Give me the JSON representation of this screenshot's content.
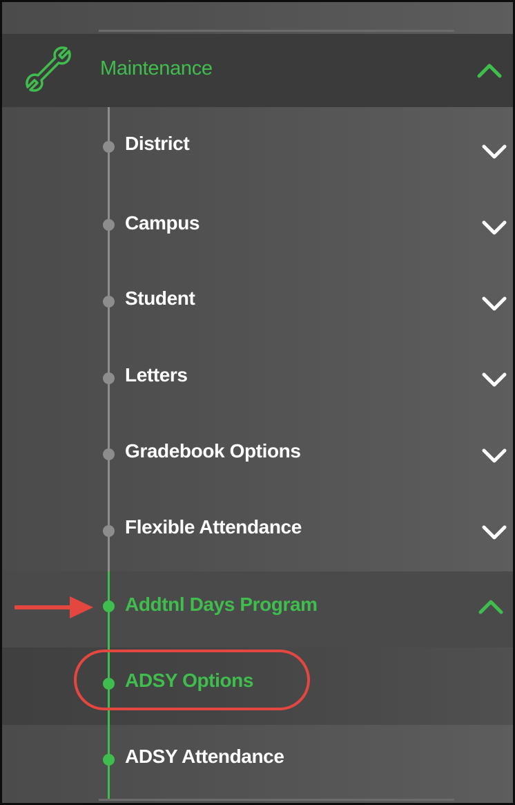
{
  "menu": {
    "header": {
      "label": "Maintenance",
      "icon": "wrench-icon",
      "expanded": true
    },
    "items": [
      {
        "label": "District",
        "expanded": false
      },
      {
        "label": "Campus",
        "expanded": false
      },
      {
        "label": "Student",
        "expanded": false
      },
      {
        "label": "Letters",
        "expanded": false
      },
      {
        "label": "Gradebook Options",
        "expanded": false
      },
      {
        "label": "Flexible Attendance",
        "expanded": false
      },
      {
        "label": "Addtnl Days Program",
        "expanded": true,
        "active": true,
        "children": [
          {
            "label": "ADSY Options",
            "highlighted": true
          },
          {
            "label": "ADSY Attendance"
          }
        ]
      }
    ]
  },
  "colors": {
    "accent_green": "#3fbe4e",
    "annotation_red": "#e4473f",
    "text_white": "#ffffff",
    "connector_gray": "#8d8d8d"
  }
}
